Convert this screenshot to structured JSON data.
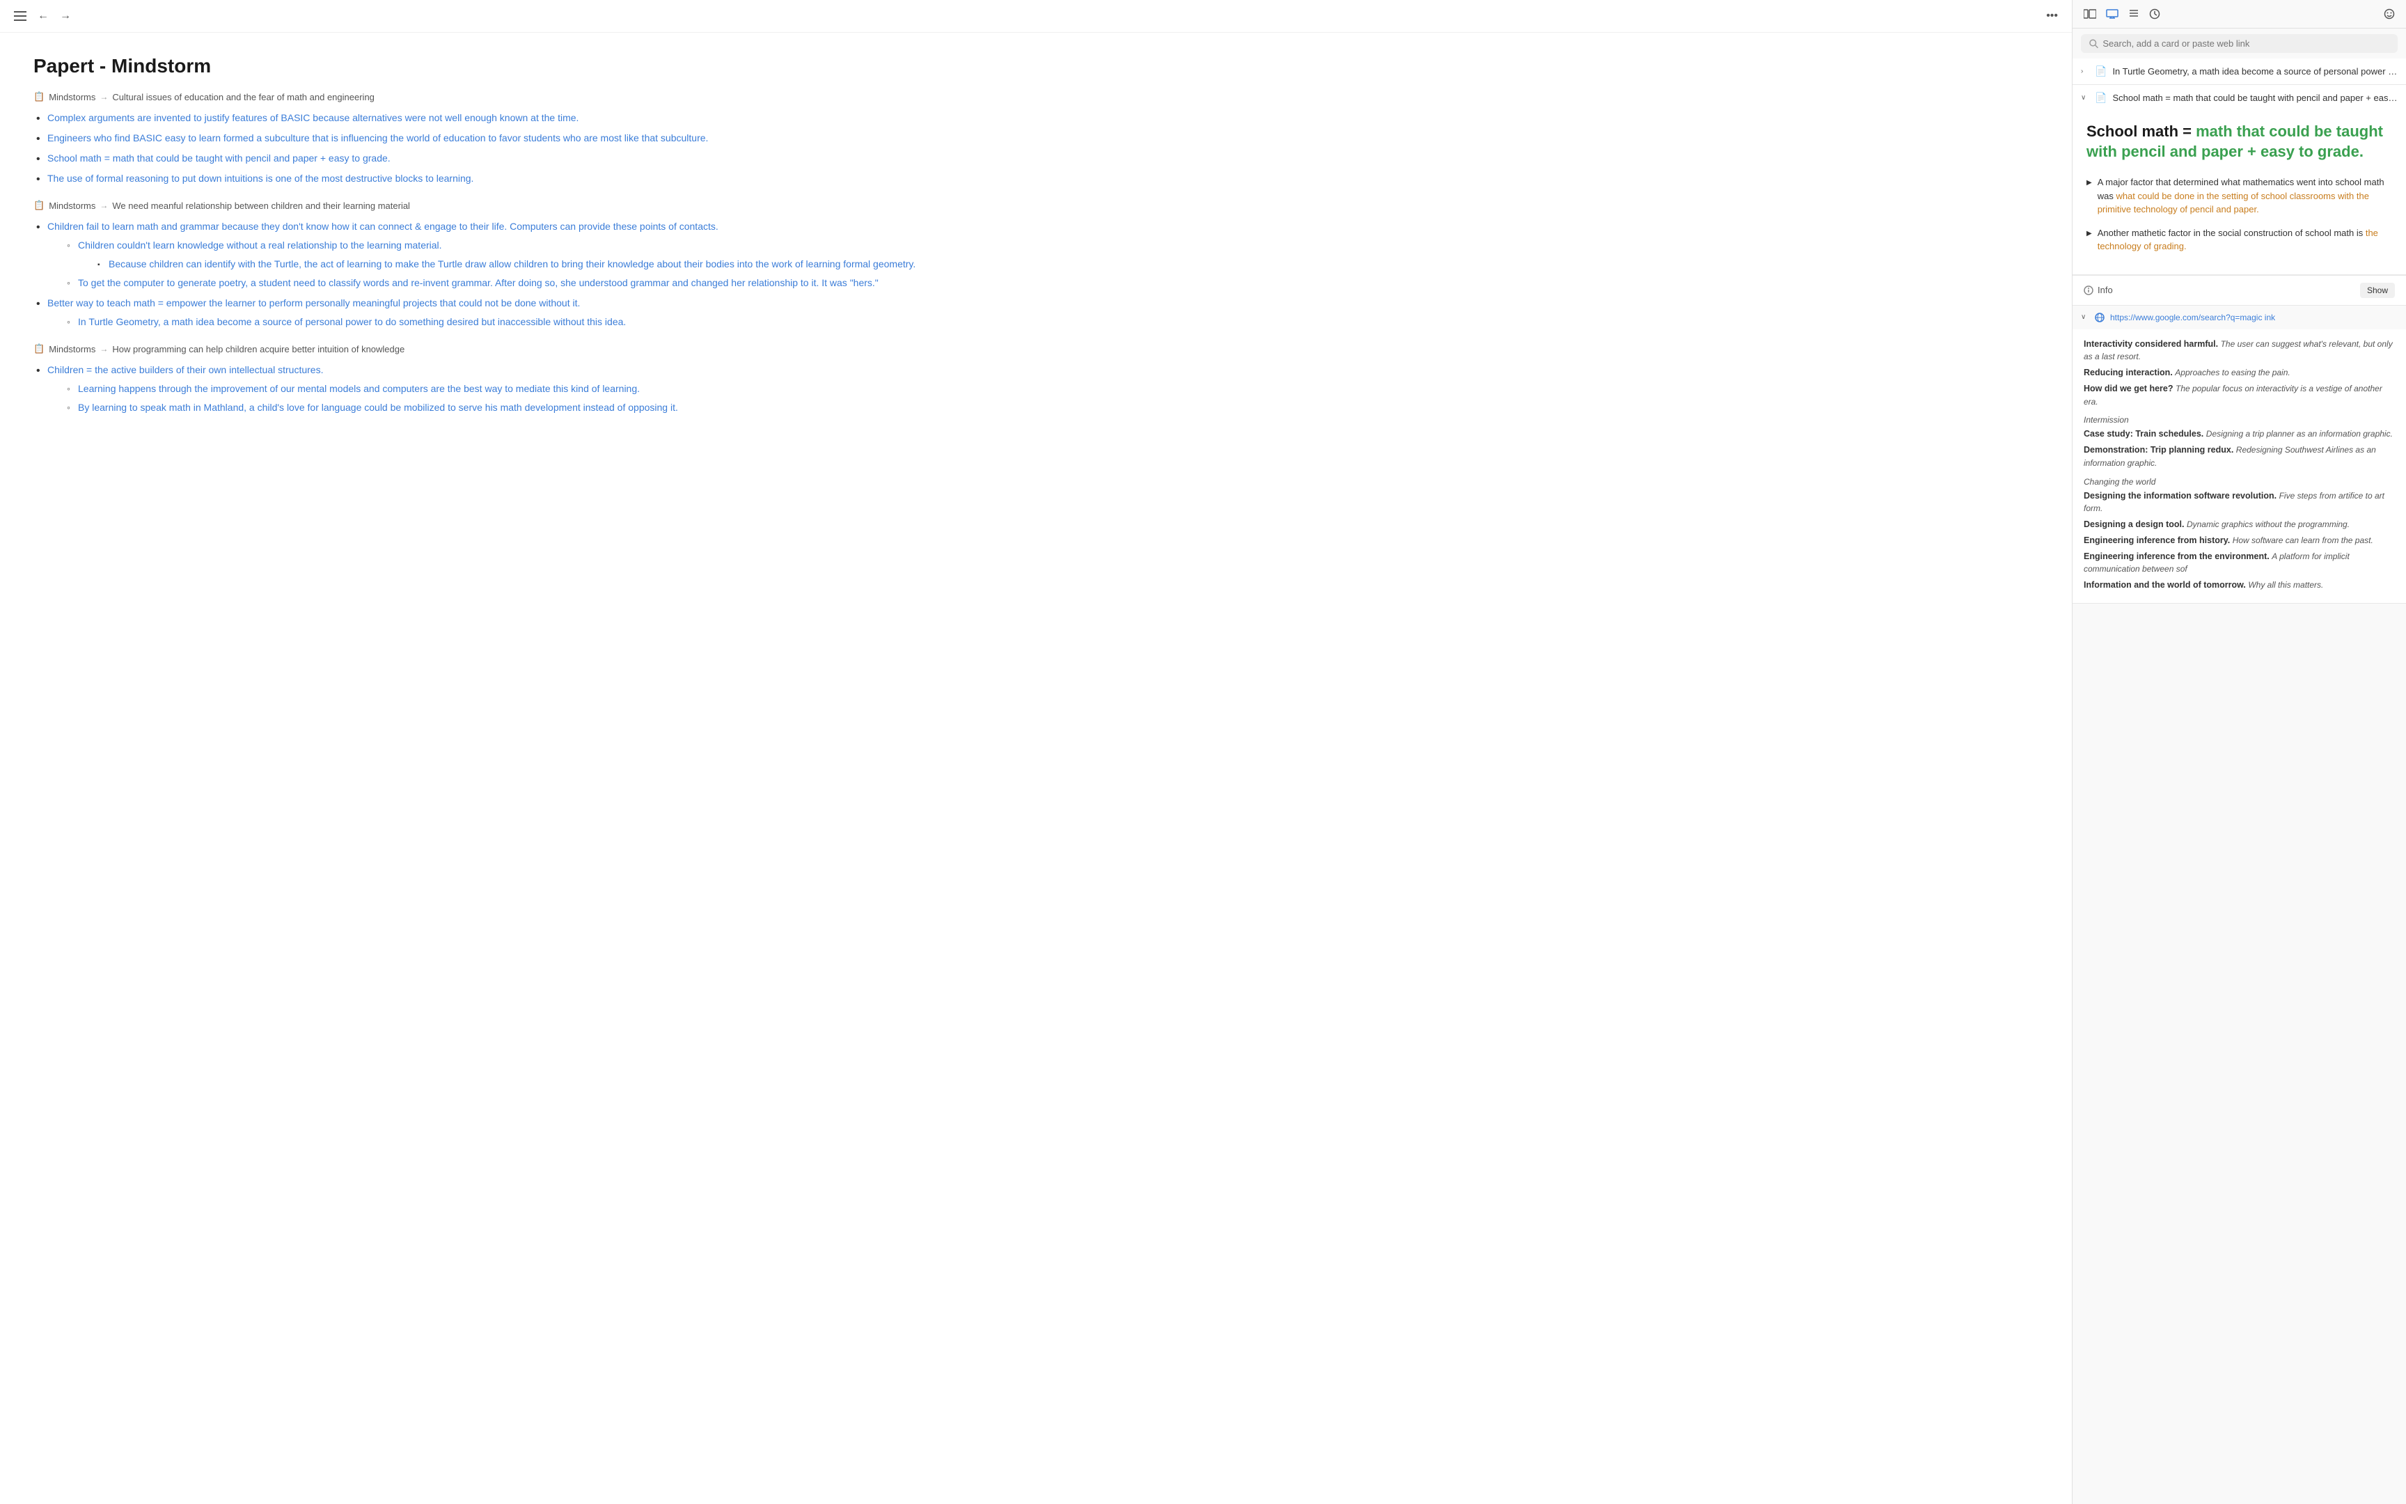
{
  "header": {
    "title": "Papert - Mindstorm",
    "back_label": "←",
    "forward_label": "→",
    "more_label": "•••"
  },
  "breadcrumbs": [
    {
      "icon": "📋",
      "source": "Mindstorms",
      "arrow": "→",
      "text": "Cultural issues of education and the fear of math and engineering"
    },
    {
      "icon": "📋",
      "source": "Mindstorms",
      "arrow": "→",
      "text": "We need meanful relationship between children and their learning material"
    },
    {
      "icon": "📋",
      "source": "Mindstorms",
      "arrow": "→",
      "text": "How programming can help children acquire better intuition of knowledge"
    }
  ],
  "sections": [
    {
      "breadcrumb_index": 0,
      "items": [
        {
          "text": "Complex arguments are invented to justify features of BASIC because alternatives were not well enough known at the time.",
          "link": true
        },
        {
          "text": "Engineers who find BASIC easy to learn formed a subculture that is influencing the world of education to favor students who are most like that subculture.",
          "link": true
        },
        {
          "text": "School math = math that could be taught with pencil and paper + easy to grade.",
          "link": true
        },
        {
          "text": "The use of formal reasoning to put down intuitions is one of the most destructive blocks to learning.",
          "link": true
        }
      ]
    },
    {
      "breadcrumb_index": 1,
      "items": [
        {
          "text": "Children fail to learn math and grammar because they don't know how it can connect & engage to their life. Computers can provide these points of contacts.",
          "link": true,
          "nested": [
            {
              "text": "Children couldn't learn knowledge without a real relationship to the learning material.",
              "link": true,
              "nested2": [
                {
                  "text": "Because children can identify with the Turtle, the act of learning to make the Turtle draw allow children to bring their knowledge about their bodies into the work of learning formal geometry.",
                  "link": true
                }
              ]
            },
            {
              "text": "To get the computer to generate poetry, a student need to classify words and re-invent grammar. After doing so, she understood grammar and changed her relationship to it. It was \"hers.\"",
              "link": true
            }
          ]
        },
        {
          "text": "Better way to teach math = empower the learner to perform personally meaningful projects that could not be done without it.",
          "link": true,
          "nested": [
            {
              "text": "In Turtle Geometry, a math idea become a source of personal power to do something desired but inaccessible without this idea.",
              "link": true
            }
          ]
        }
      ]
    },
    {
      "breadcrumb_index": 2,
      "items": [
        {
          "text": "Children = the active builders of their own intellectual structures.",
          "link": true,
          "nested": [
            {
              "text": "Learning happens through the improvement of our mental models and computers are the best way to mediate this kind of learning.",
              "link": true
            },
            {
              "text": "By learning to speak math in Mathland, a child's love for language could be mobilized to serve his math development instead of opposing it.",
              "link": true
            }
          ]
        }
      ]
    }
  ],
  "right_panel": {
    "search_placeholder": "Search, add a card or paste web link",
    "cards": [
      {
        "id": "collapsed_card",
        "expanded": false,
        "icon": "📄",
        "title": "In Turtle Geometry, a math idea become a source of personal power to d..."
      },
      {
        "id": "school_math_card",
        "expanded": true,
        "icon": "📄",
        "title_display": "School math = math that could be taught with pencil and paper + easy to...",
        "expanded_title_part1": "School math = ",
        "expanded_title_highlight": "math that could be taught with pencil and paper + easy to grade.",
        "expanded_title_highlight_color": "#3aa050",
        "bullets": [
          {
            "text_prefix": "A major factor that determined what mathematics went into school math was ",
            "text_highlight": "what could be done in the setting of school classrooms with the primitive technology of pencil and paper.",
            "highlight_color": "#c87d1e"
          },
          {
            "text_prefix": "Another mathetic factor in the social construction of school math is ",
            "text_highlight": "the technology of grading.",
            "highlight_color": "#c87d1e"
          }
        ]
      }
    ],
    "info_label": "Info",
    "show_label": "Show",
    "web_card": {
      "url": "https://www.google.com/search?q=magic ink",
      "sections": [
        {
          "type": "content",
          "lines": [
            {
              "bold": "Interactivity considered harmful.",
              "italic": "The user can suggest what's relevant, but only as a last resort."
            },
            {
              "bold": "Reducing interaction.",
              "italic": "Approaches to easing the pain."
            },
            {
              "bold": "How did we get here?",
              "italic": "The popular focus on interactivity is a vestige of another era."
            }
          ]
        },
        {
          "type": "section_header",
          "text": "Intermission"
        },
        {
          "type": "content",
          "lines": [
            {
              "bold": "Case study: Train schedules.",
              "italic": "Designing a trip planner as an information graphic."
            },
            {
              "bold": "Demonstration: Trip planning redux.",
              "italic": "Redesigning Southwest Airlines as an information graphic."
            }
          ]
        },
        {
          "type": "section_header",
          "text": "Changing the world"
        },
        {
          "type": "content",
          "lines": [
            {
              "bold": "Designing the information software revolution.",
              "italic": "Five steps from artifice to art form."
            },
            {
              "bold": "Designing a design tool.",
              "italic": "Dynamic graphics without the programming."
            },
            {
              "bold": "Engineering inference from history.",
              "italic": "How software can learn from the past."
            },
            {
              "bold": "Engineering inference from the environment.",
              "italic": "A platform for implicit communication between sof"
            },
            {
              "bold": "Information and the world of tomorrow.",
              "italic": "Why all this matters."
            }
          ]
        }
      ]
    }
  },
  "icons": {
    "back": "←",
    "forward": "→",
    "more": "•••",
    "sidebar": "⬛",
    "monitor": "🖥",
    "list": "≡",
    "clock": "⏱",
    "smiley": "☺",
    "search": "🔍",
    "info": "ℹ",
    "globe": "🌐",
    "chevron_right": "›",
    "chevron_down": "∨",
    "triangle": "▶"
  }
}
